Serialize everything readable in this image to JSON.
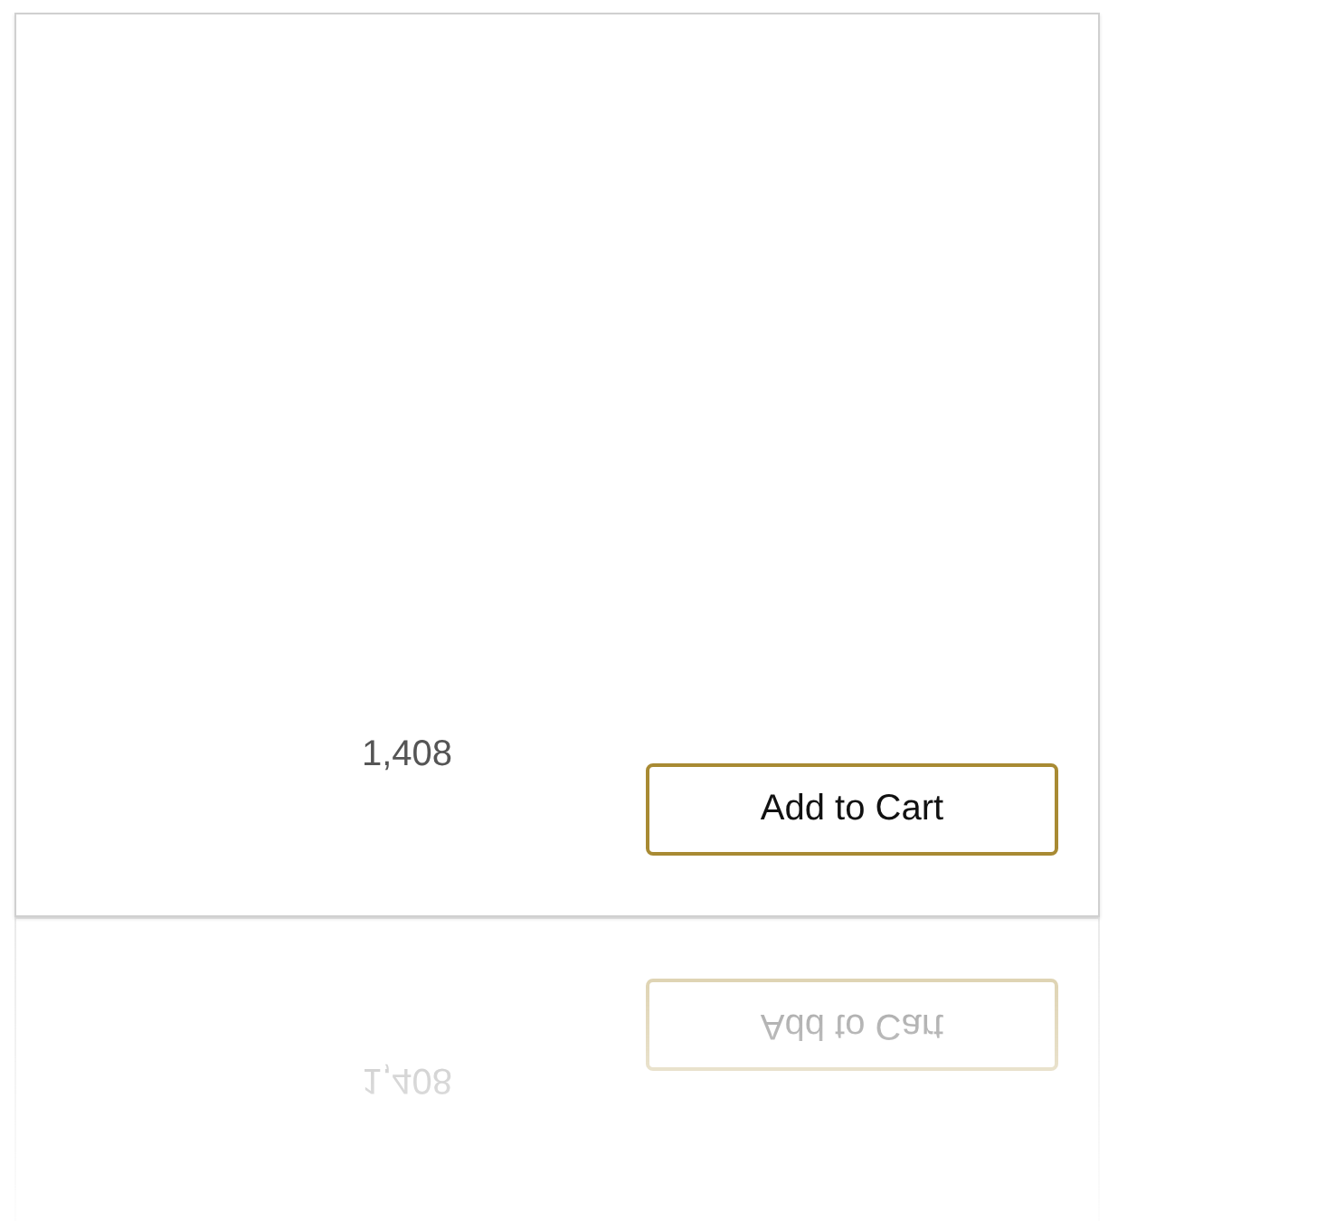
{
  "product": {
    "count": "1,408",
    "button": "Add to Cart"
  }
}
